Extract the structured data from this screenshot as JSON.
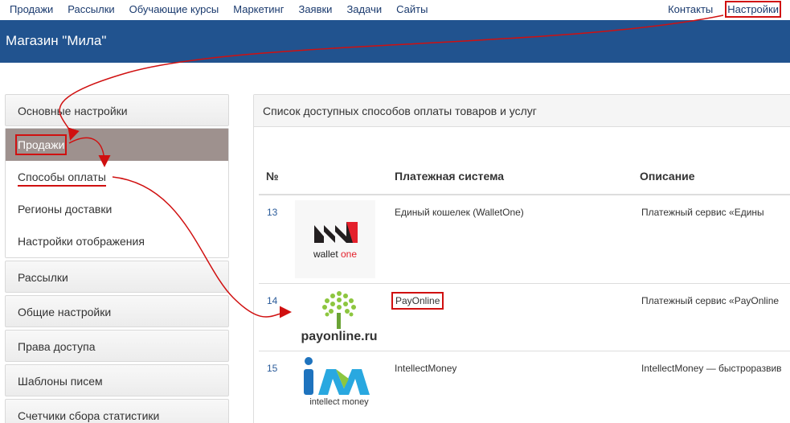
{
  "topnav": {
    "left": [
      "Продажи",
      "Рассылки",
      "Обучающие курсы",
      "Маркетинг",
      "Заявки",
      "Задачи",
      "Сайты"
    ],
    "right": [
      "Контакты",
      "Настройки"
    ]
  },
  "header": {
    "title": "Магазин \"Мила\""
  },
  "sidebar": {
    "item_main": "Основные настройки",
    "group_active": "Продажи",
    "sub": [
      "Способы оплаты",
      "Регионы доставки",
      "Настройки отображения"
    ],
    "items": [
      "Рассылки",
      "Общие настройки",
      "Права доступа",
      "Шаблоны писем",
      "Счетчики сбора статистики"
    ]
  },
  "panel": {
    "title": "Список доступных способов оплаты товаров и услуг",
    "columns": [
      "№",
      "Платежная система",
      "Описание"
    ],
    "rows": [
      {
        "num": "13",
        "logo_text": "wallet one",
        "logo_accent": "one",
        "name": "Единый кошелек (WalletOne)",
        "desc": "Платежный сервис «Едины"
      },
      {
        "num": "14",
        "logo_text": "payonline.ru",
        "name": "PayOnline",
        "desc": "Платежный сервис «PayOnline"
      },
      {
        "num": "15",
        "logo_text": "intellect money",
        "name": "IntellectMoney",
        "desc": "IntellectMoney — быстроразвив"
      }
    ]
  },
  "colors": {
    "header": "#21538f",
    "link": "#1a3a6e",
    "annotation": "#d01010",
    "active": "#9e918e"
  }
}
